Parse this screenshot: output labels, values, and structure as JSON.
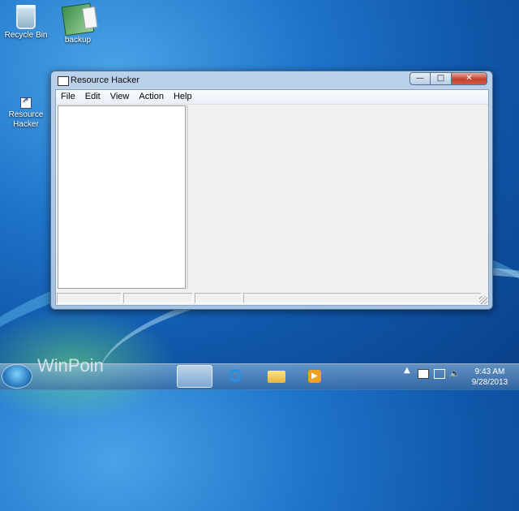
{
  "desktop": {
    "icons": [
      {
        "label": "Recycle Bin"
      },
      {
        "label": "backup"
      },
      {
        "label": "Resource Hacker"
      }
    ],
    "watermark": "WinPoin"
  },
  "window": {
    "title": "Resource Hacker",
    "menu": [
      "File",
      "Edit",
      "View",
      "Action",
      "Help"
    ],
    "controls": {
      "minimize": "—",
      "maximize": "□",
      "close": "✕"
    }
  },
  "taskbar": {
    "tray_arrow": "▲",
    "clock_time": "9:43 AM",
    "clock_date": "9/28/2013"
  }
}
